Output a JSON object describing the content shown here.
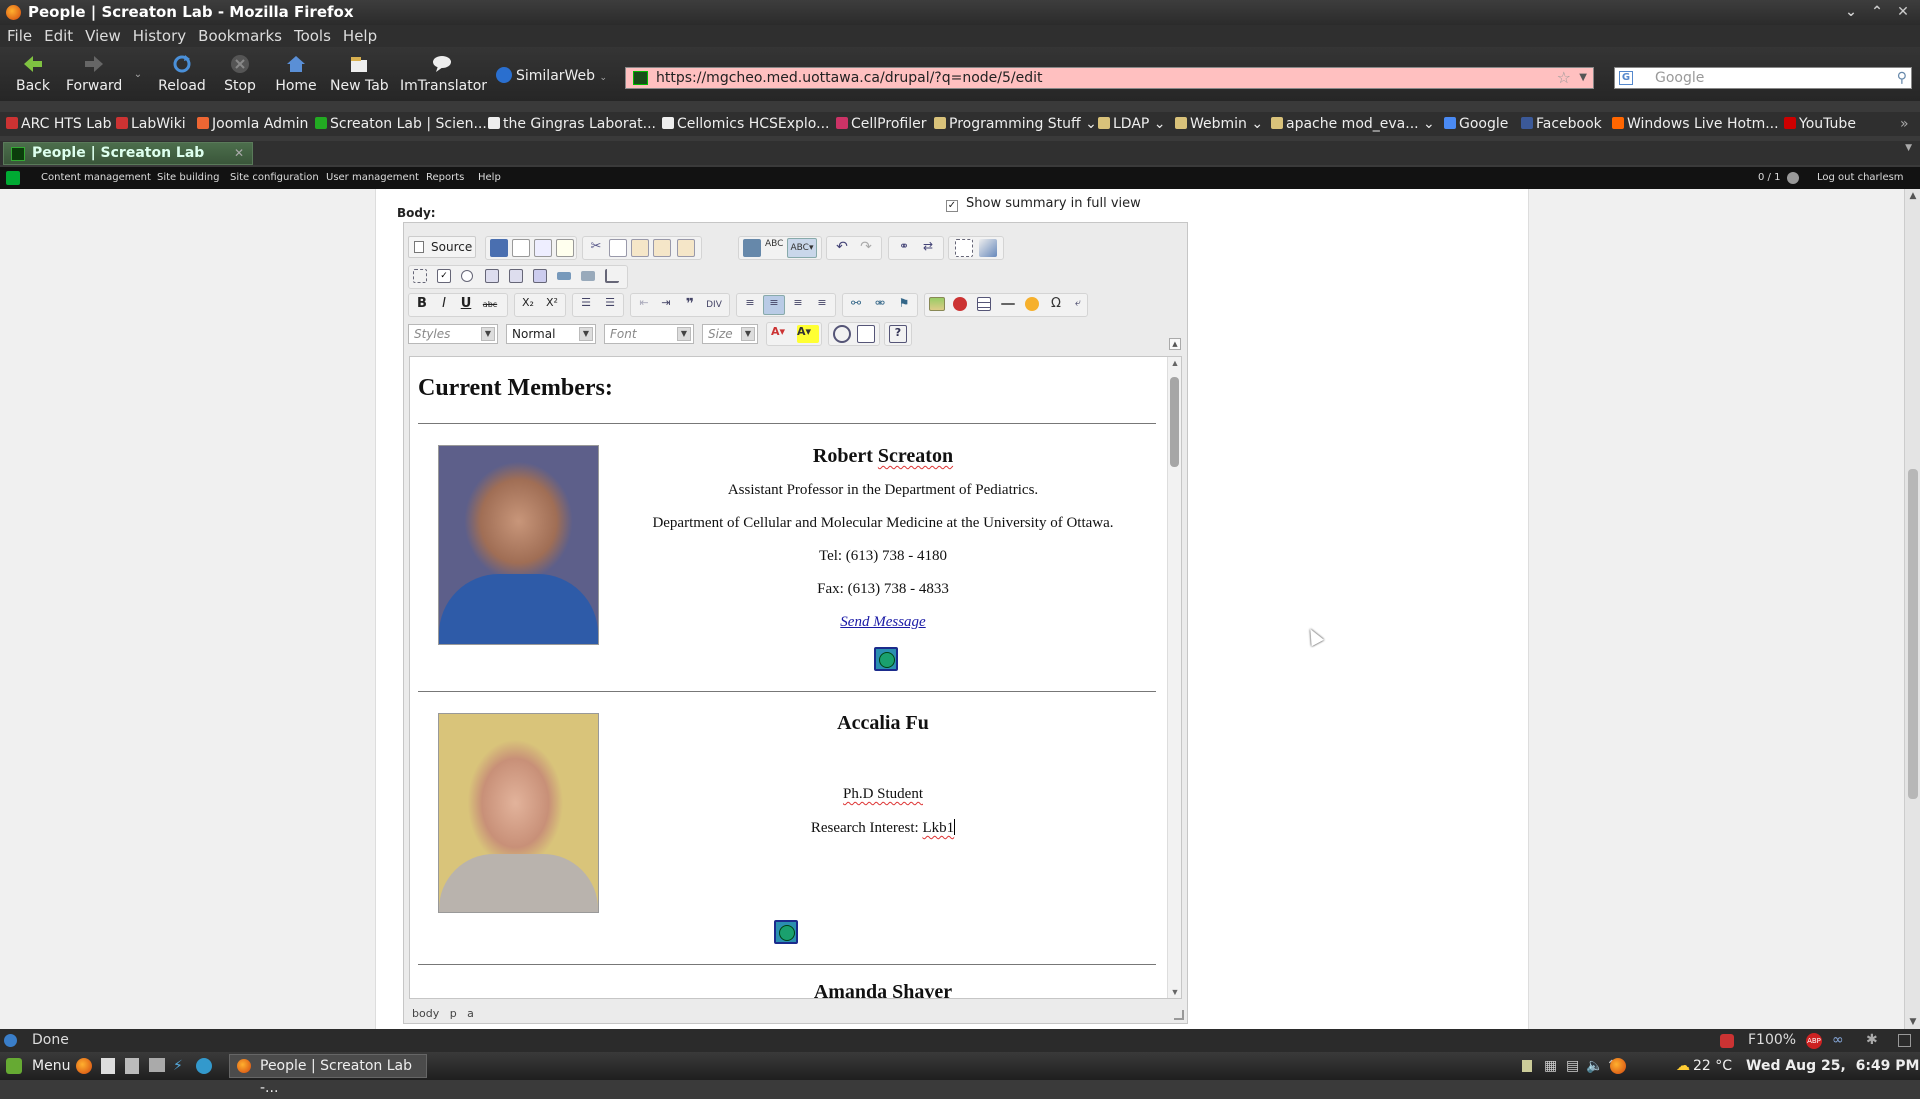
{
  "window": {
    "title": "People | Screaton Lab - Mozilla Firefox"
  },
  "menu": [
    "File",
    "Edit",
    "View",
    "History",
    "Bookmarks",
    "Tools",
    "Help"
  ],
  "nav": {
    "back": "Back",
    "forward": "Forward",
    "reload": "Reload",
    "stop": "Stop",
    "home": "Home",
    "new_tab": "New Tab",
    "imtranslator": "ImTranslator",
    "similarweb": "SimilarWeb"
  },
  "url": "https://mgcheo.med.uottawa.ca/drupal/?q=node/5/edit",
  "search": {
    "placeholder": "Google"
  },
  "bookmarks": [
    "ARC HTS Lab",
    "LabWiki",
    "Joomla Admin",
    "Screaton Lab | Scien...",
    "the Gingras Laborat...",
    "Cellomics HCSExplo...",
    "CellProfiler",
    "Programming Stuff",
    "LDAP",
    "Webmin",
    "apache mod_eva...",
    "Google",
    "Facebook",
    "Windows Live Hotm...",
    "YouTube"
  ],
  "tab": {
    "label": "People | Screaton Lab"
  },
  "admin": {
    "items": [
      "Content management",
      "Site building",
      "Site configuration",
      "User management",
      "Reports",
      "Help"
    ],
    "counter": "0 / 1",
    "logout": "Log out charlesm"
  },
  "form": {
    "body_label": "Body:",
    "summary_label": "Show summary in full view"
  },
  "editor_toolbar": {
    "source": "Source",
    "styles": "Styles",
    "format": "Normal",
    "font": "Font",
    "size": "Size"
  },
  "document": {
    "heading": "Current Members:",
    "members": [
      {
        "name": "Robert Screaton",
        "lines": [
          "Assistant Professor in the Department of Pediatrics.",
          "Department of Cellular and Molecular Medicine at the University of Ottawa.",
          "Tel:  (613) 738 - 4180",
          "Fax: (613) 738 - 4833"
        ],
        "link": "Send Message"
      },
      {
        "name": "Accalia Fu",
        "role": "Ph.D Student",
        "interest_label": "Research Interest: ",
        "interest_value": "Lkb1"
      },
      {
        "name": "Amanda Shaver"
      }
    ]
  },
  "editor_status": "body   p   a",
  "status": {
    "text": "Done",
    "zoom": "F100%",
    "temperature": "22 °C",
    "clock": "Wed Aug 25,  6:49 PM"
  },
  "taskbar": {
    "menu": "Menu",
    "task": "People | Screaton Lab -..."
  }
}
